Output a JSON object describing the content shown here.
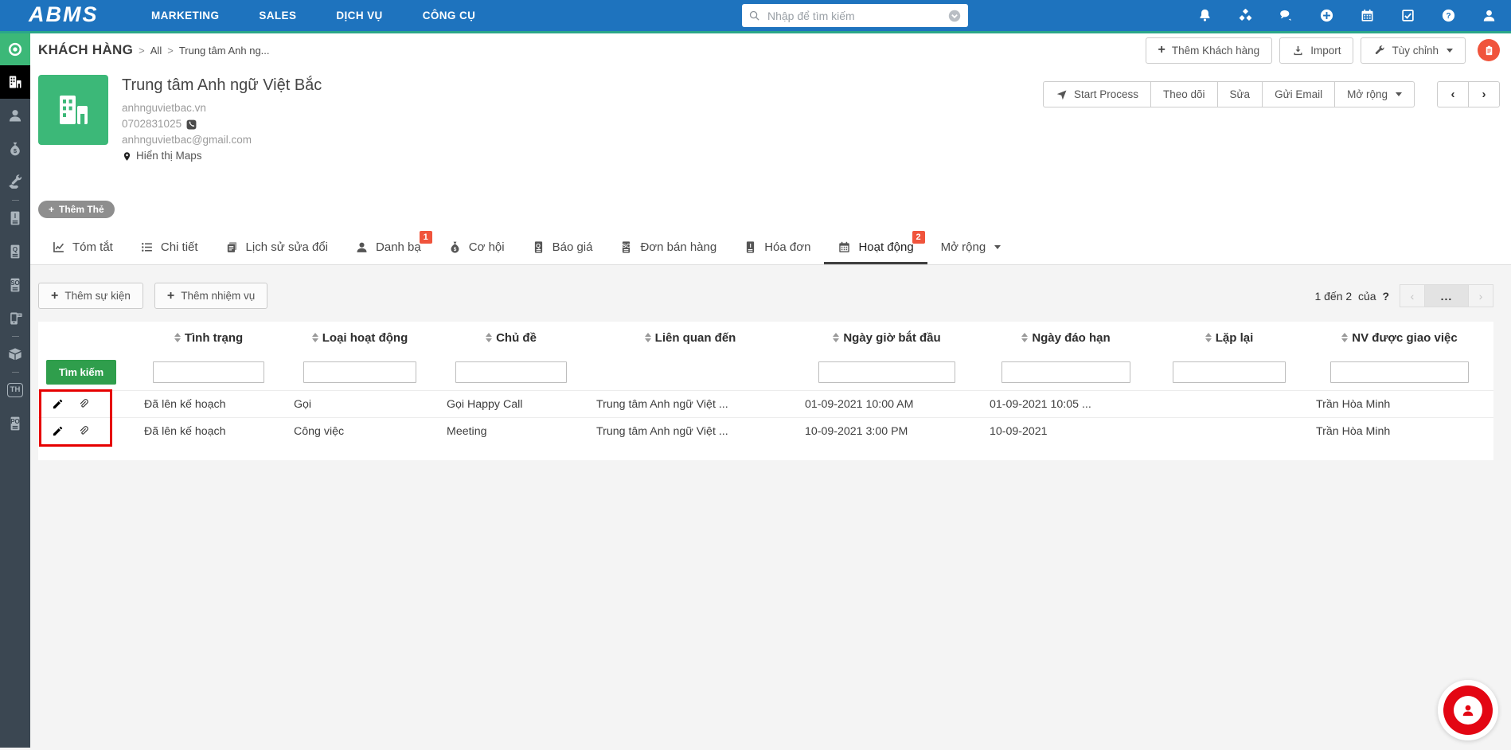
{
  "app": {
    "logo": "ABMS"
  },
  "topnav": {
    "menu": [
      {
        "label": "MARKETING"
      },
      {
        "label": "SALES"
      },
      {
        "label": "DỊCH VỤ"
      },
      {
        "label": "CÔNG CỤ"
      }
    ],
    "search": {
      "placeholder": "Nhập để tìm kiếm"
    },
    "icons": [
      "bell",
      "apps",
      "chat",
      "plus",
      "calendar",
      "tasks",
      "help",
      "user"
    ]
  },
  "sidebar": {
    "items": [
      {
        "name": "home-dashboard"
      },
      {
        "name": "organizations"
      },
      {
        "name": "contacts"
      },
      {
        "name": "opportunities"
      },
      {
        "name": "services"
      },
      {
        "name": "invoices",
        "glyph": "I"
      },
      {
        "name": "quotes",
        "glyph": "Q"
      },
      {
        "name": "sales-orders",
        "glyph": "SO"
      },
      {
        "name": "sms-messages"
      },
      {
        "name": "products"
      },
      {
        "name": "th-module",
        "glyph": "TH"
      },
      {
        "name": "purchase-orders",
        "glyph": "PO"
      }
    ]
  },
  "breadcrumb": {
    "root": "KHÁCH HÀNG",
    "sep": ">",
    "mid": "All",
    "leaf": "Trung tâm Anh ng..."
  },
  "list_actions": {
    "add_customer": "Thêm Khách hàng",
    "import": "Import",
    "customize": "Tùy chỉnh"
  },
  "record": {
    "name": "Trung tâm Anh ngữ Việt Bắc",
    "website": "anhnguvietbac.vn",
    "phone": "0702831025",
    "email": "anhnguvietbac@gmail.com",
    "maps_label": "Hiển thị Maps",
    "add_tag_label": "Thêm Thẻ"
  },
  "record_actions": {
    "start_process": "Start Process",
    "follow": "Theo dõi",
    "edit": "Sửa",
    "send_email": "Gửi Email",
    "more": "Mở rộng",
    "prev": "‹",
    "next": "›"
  },
  "tabs": [
    {
      "label": "Tóm tắt",
      "icon": "chart"
    },
    {
      "label": "Chi tiết",
      "icon": "list"
    },
    {
      "label": "Lịch sử sửa đổi",
      "icon": "history"
    },
    {
      "label": "Danh bạ",
      "icon": "person",
      "badge": "1"
    },
    {
      "label": "Cơ hội",
      "icon": "moneybag"
    },
    {
      "label": "Báo giá",
      "icon": "doc",
      "glyph": "Q"
    },
    {
      "label": "Đơn bán hàng",
      "icon": "doc",
      "glyph": "SO"
    },
    {
      "label": "Hóa đơn",
      "icon": "doc",
      "glyph": "I"
    },
    {
      "label": "Hoạt động",
      "icon": "calendar",
      "badge": "2",
      "active": true
    },
    {
      "label": "Mở rộng",
      "icon": "caret"
    }
  ],
  "related": {
    "add_event": "Thêm sự kiện",
    "add_task": "Thêm nhiệm vụ",
    "search_button": "Tìm kiếm",
    "pagination": {
      "range": "1 đến 2",
      "of": "của",
      "total": "?",
      "ellipsis": "...",
      "prev": "‹",
      "next": "›"
    }
  },
  "table": {
    "columns": [
      {
        "label": "Tình trạng",
        "has_input": true
      },
      {
        "label": "Loại hoạt động",
        "has_input": true
      },
      {
        "label": "Chủ đề",
        "has_input": true
      },
      {
        "label": "Liên quan đến",
        "has_input": false
      },
      {
        "label": "Ngày giờ bắt đầu",
        "has_input": true
      },
      {
        "label": "Ngày đáo hạn",
        "has_input": true
      },
      {
        "label": "Lặp lại",
        "has_input": true
      },
      {
        "label": "NV được giao việc",
        "has_input": true
      }
    ],
    "rows": [
      {
        "cells": [
          "Đã lên kế hoạch",
          "Gọi",
          "Gọi Happy Call",
          "Trung tâm Anh ngữ Việt ...",
          "01-09-2021 10:00 AM",
          "01-09-2021 10:05 ...",
          "",
          "Trần Hòa Minh"
        ]
      },
      {
        "cells": [
          "Đã lên kế hoạch",
          "Công việc",
          "Meeting",
          "Trung tâm Anh ngữ Việt ...",
          "10-09-2021 3:00 PM",
          "10-09-2021",
          "",
          "Trần Hòa Minh"
        ]
      }
    ]
  },
  "colors": {
    "navbar_blue": "#1e73be",
    "accent_line": "#2aa789",
    "sidebar_dark": "#3b4752",
    "brand_green": "#3cb878",
    "badge_red": "#f0543c",
    "search_green": "#2f9e4c",
    "annotation_red": "#e60000",
    "widget_red": "#e30613"
  }
}
